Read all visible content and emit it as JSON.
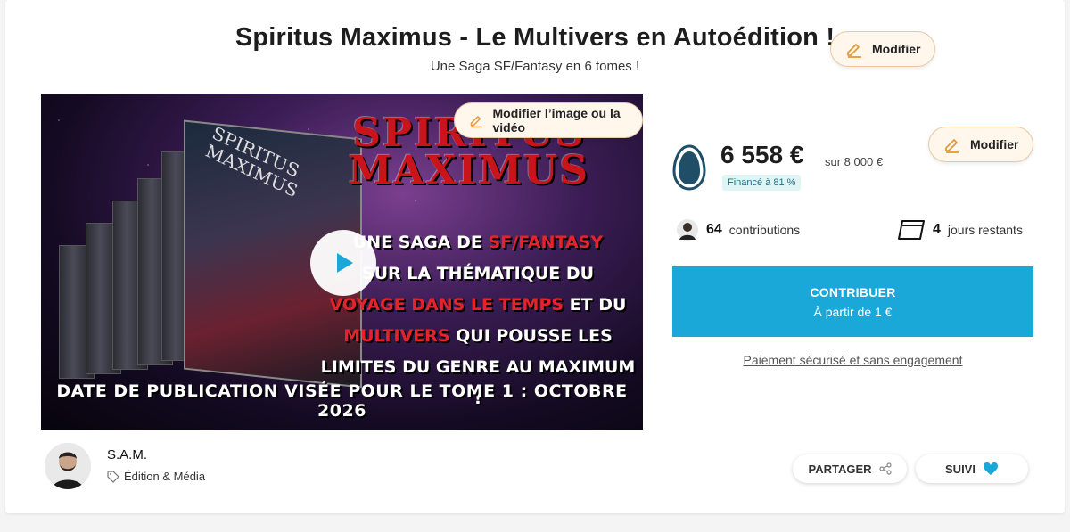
{
  "header": {
    "title": "Spiritus Maximus - Le Multivers en Autoédition !",
    "subtitle": "Une Saga SF/Fantasy en 6 tomes !",
    "edit_label": "Modifier"
  },
  "media": {
    "edit_label": "Modifier l’image ou la vidéo",
    "cover_title": "SPIRITUS MAXIMUS",
    "headline": "SPIRITUS MAXIMUS",
    "tagline_1": "UNE SAGA DE ",
    "tagline_1_red": "SF/FANTASY",
    "tagline_2": "SUR LA THÉMATIQUE DU",
    "tagline_3_red": "VOYAGE DANS LE TEMPS",
    "tagline_3": " ET DU",
    "tagline_4_red": "MULTIVERS",
    "tagline_4": " QUI POUSSE LES",
    "tagline_5": "LIMITES DU GENRE AU MAXIMUM !",
    "publication": "DATE DE PUBLICATION VISÉE POUR LE TOME 1 : OCTOBRE 2026",
    "play_icon": "play-icon"
  },
  "stats": {
    "edit_label": "Modifier",
    "amount": "6 558 €",
    "goal": "sur 8 000 €",
    "funded": "Financé à 81 %",
    "funded_fraction": 0.81,
    "contributions_count": "64",
    "contributions_label": "contributions",
    "days_count": "4",
    "days_label": "jours restants"
  },
  "cta": {
    "label": "CONTRIBUER",
    "sub": "À partir de 1 €",
    "secure": "Paiement sécurisé et sans engagement"
  },
  "author": {
    "name": "S.A.M.",
    "category": "Édition & Média"
  },
  "actions": {
    "share": "PARTAGER",
    "follow": "SUIVI"
  },
  "colors": {
    "accent": "#19a8d8",
    "edit_bg": "#fff6ec",
    "edit_border": "#e9c9a1",
    "pencil": "#e39a3c",
    "funded_bg": "#dff4f4",
    "heart": "#19a8d8"
  }
}
